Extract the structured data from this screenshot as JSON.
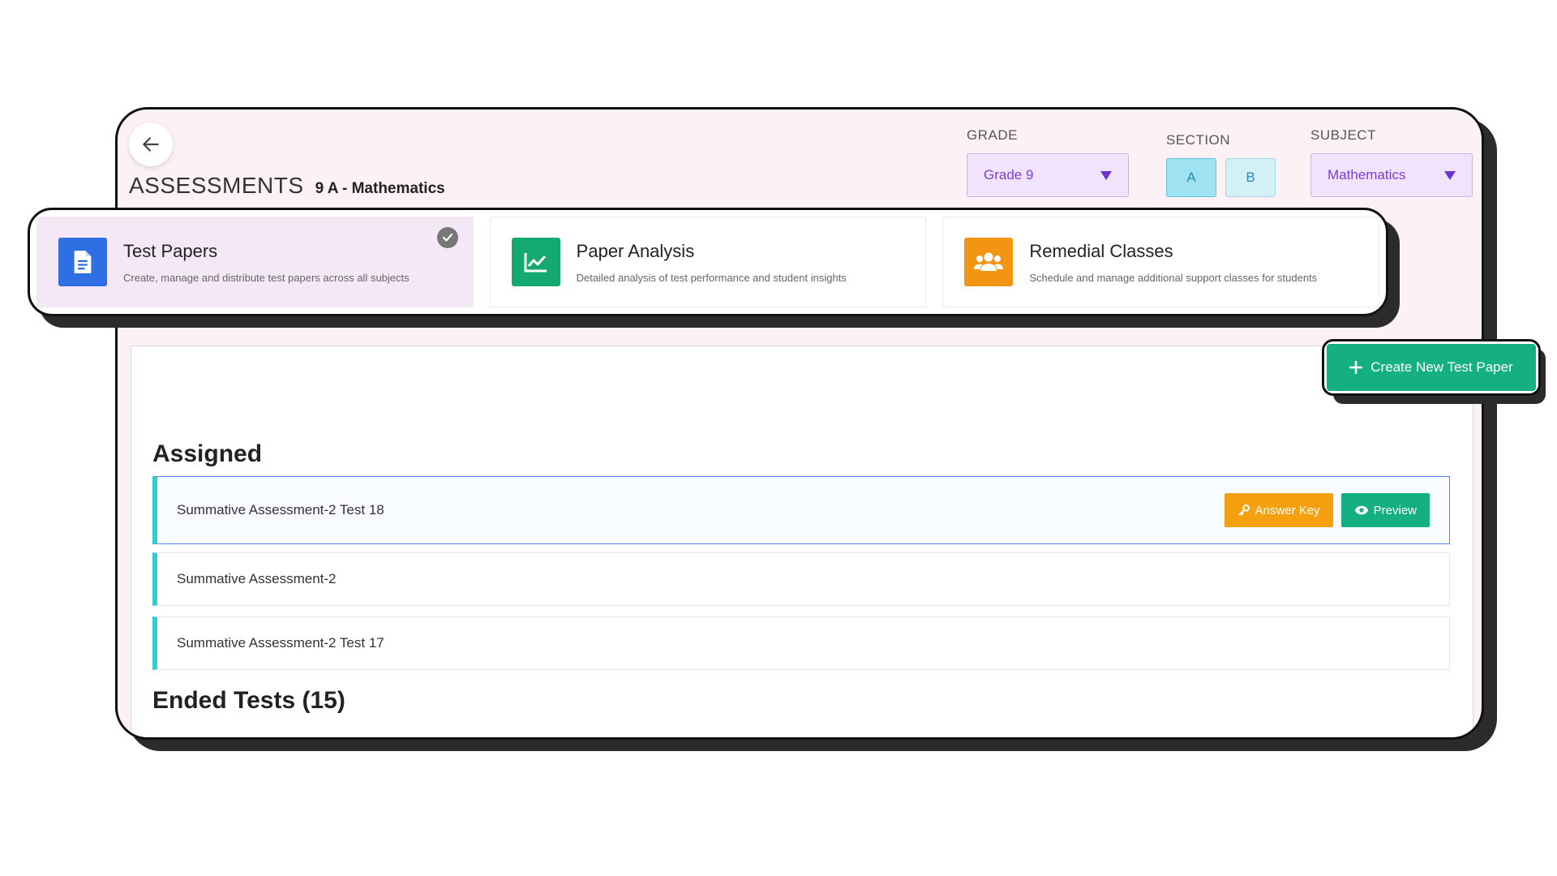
{
  "header": {
    "title": "ASSESSMENTS",
    "context": "9 A - Mathematics"
  },
  "filters": {
    "grade_label": "GRADE",
    "grade_value": "Grade 9",
    "section_label": "SECTION",
    "sections": [
      "A",
      "B"
    ],
    "subject_label": "SUBJECT",
    "subject_value": "Mathematics"
  },
  "features": [
    {
      "title": "Test Papers",
      "desc": "Create, manage and distribute test papers across all subjects",
      "color": "#2f6fe4",
      "icon": "document-icon"
    },
    {
      "title": "Paper Analysis",
      "desc": "Detailed analysis of test performance and student insights",
      "color": "#13a970",
      "icon": "chart-icon"
    },
    {
      "title": "Remedial Classes",
      "desc": "Schedule and manage additional support classes for students",
      "color": "#f39512",
      "icon": "users-icon"
    }
  ],
  "actions": {
    "create_label": "Create New Test Paper",
    "answer_key_label": "Answer Key",
    "preview_label": "Preview"
  },
  "assigned": {
    "heading": "Assigned",
    "items": [
      "Summative Assessment-2 Test 18",
      "Summative Assessment-2",
      "Summative Assessment-2 Test 17"
    ]
  },
  "ended": {
    "heading": "Ended Tests (15)"
  }
}
